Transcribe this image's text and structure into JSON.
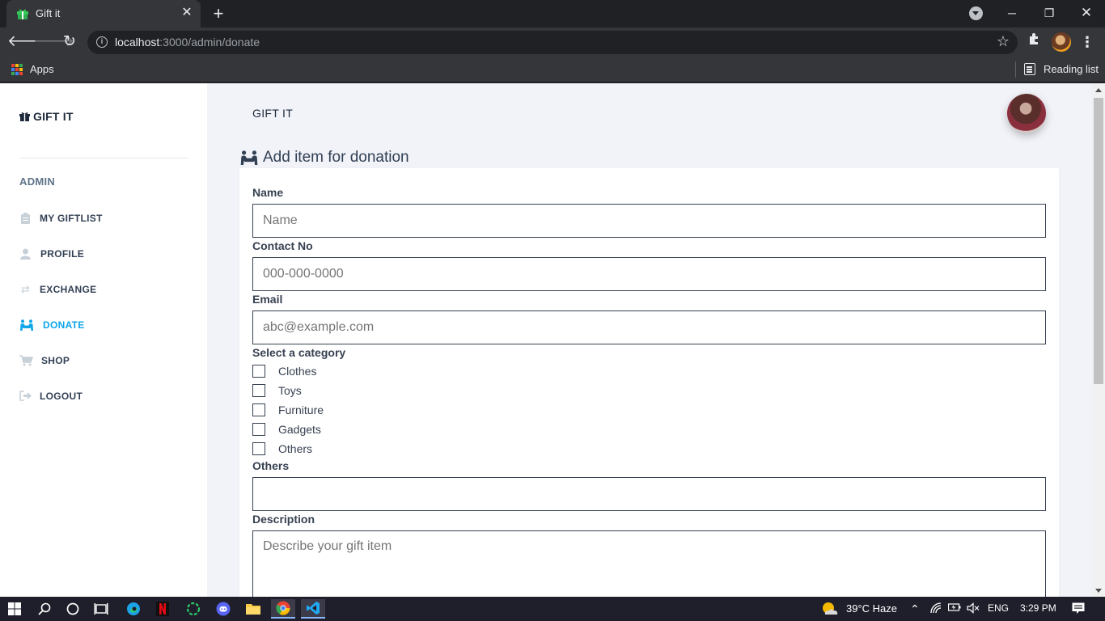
{
  "browser": {
    "tab_title": "Gift it",
    "url_host": "localhost",
    "url_rest": ":3000/admin/donate",
    "bookmark_apps": "Apps",
    "reading_list": "Reading list"
  },
  "sidebar": {
    "brand": "GIFT IT",
    "heading": "ADMIN",
    "items": [
      {
        "label": "MY GIFTLIST",
        "icon": "clipboard-icon"
      },
      {
        "label": "PROFILE",
        "icon": "user-icon"
      },
      {
        "label": "EXCHANGE",
        "icon": "exchange-arrows-icon"
      },
      {
        "label": "DONATE",
        "icon": "people-carry-icon"
      },
      {
        "label": "SHOP",
        "icon": "cart-icon"
      },
      {
        "label": "LOGOUT",
        "icon": "logout-icon"
      }
    ],
    "active_item": "DONATE"
  },
  "topbar": {
    "brand": "GIFT IT"
  },
  "form": {
    "title": "Add item for donation",
    "name_label": "Name",
    "name_placeholder": "Name",
    "contact_label": "Contact No",
    "contact_placeholder": "000-000-0000",
    "email_label": "Email",
    "email_placeholder": "abc@example.com",
    "category_label": "Select a category",
    "categories": [
      "Clothes",
      "Toys",
      "Furniture",
      "Gadgets",
      "Others"
    ],
    "others_label": "Others",
    "others_value": "",
    "description_label": "Description",
    "description_placeholder": "Describe your gift item"
  },
  "taskbar": {
    "weather": "39°C  Haze",
    "language": "ENG",
    "time": "3:29 PM"
  },
  "colors": {
    "accent": "#0ea5e9",
    "page_bg": "#f1f3f8",
    "text_dark": "#334155"
  }
}
